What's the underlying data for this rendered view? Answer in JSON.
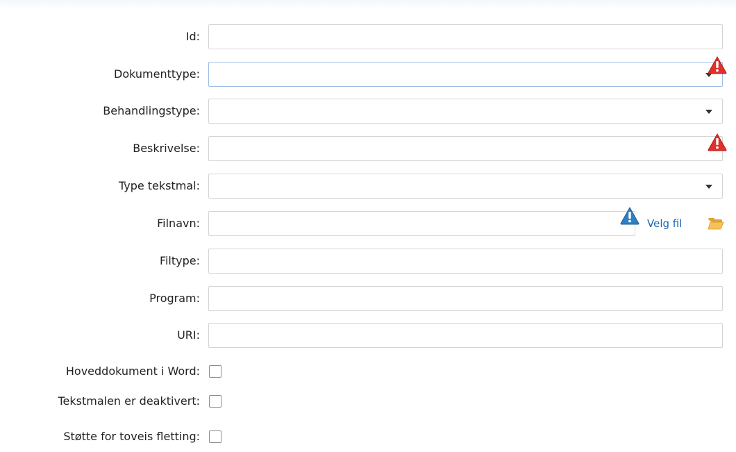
{
  "form": {
    "id": {
      "label": "Id:",
      "value": ""
    },
    "dokumenttype": {
      "label": "Dokumenttype:",
      "value": ""
    },
    "behandlingstype": {
      "label": "Behandlingstype:",
      "value": ""
    },
    "beskrivelse": {
      "label": "Beskrivelse:",
      "value": ""
    },
    "type_tekstmal": {
      "label": "Type tekstmal:",
      "value": ""
    },
    "filnavn": {
      "label": "Filnavn:",
      "value": "",
      "velg_fil_label": "Velg fil"
    },
    "filtype": {
      "label": "Filtype:",
      "value": ""
    },
    "program": {
      "label": "Program:",
      "value": ""
    },
    "uri": {
      "label": "URI:",
      "value": ""
    },
    "hoveddokument": {
      "label": "Hoveddokument i Word:",
      "checked": false
    },
    "deaktivert": {
      "label": "Tekstmalen er deaktivert:",
      "checked": false
    },
    "toveis": {
      "label": "Støtte for toveis fletting:",
      "checked": false
    }
  },
  "icons": {
    "required": "red-warning-triangle-icon",
    "info": "blue-info-triangle-icon",
    "folder": "folder-icon"
  },
  "colors": {
    "required_icon": "#e0312a",
    "info_icon": "#2f7fc1",
    "link": "#1a64b5",
    "focus_border": "#9cbde6"
  }
}
